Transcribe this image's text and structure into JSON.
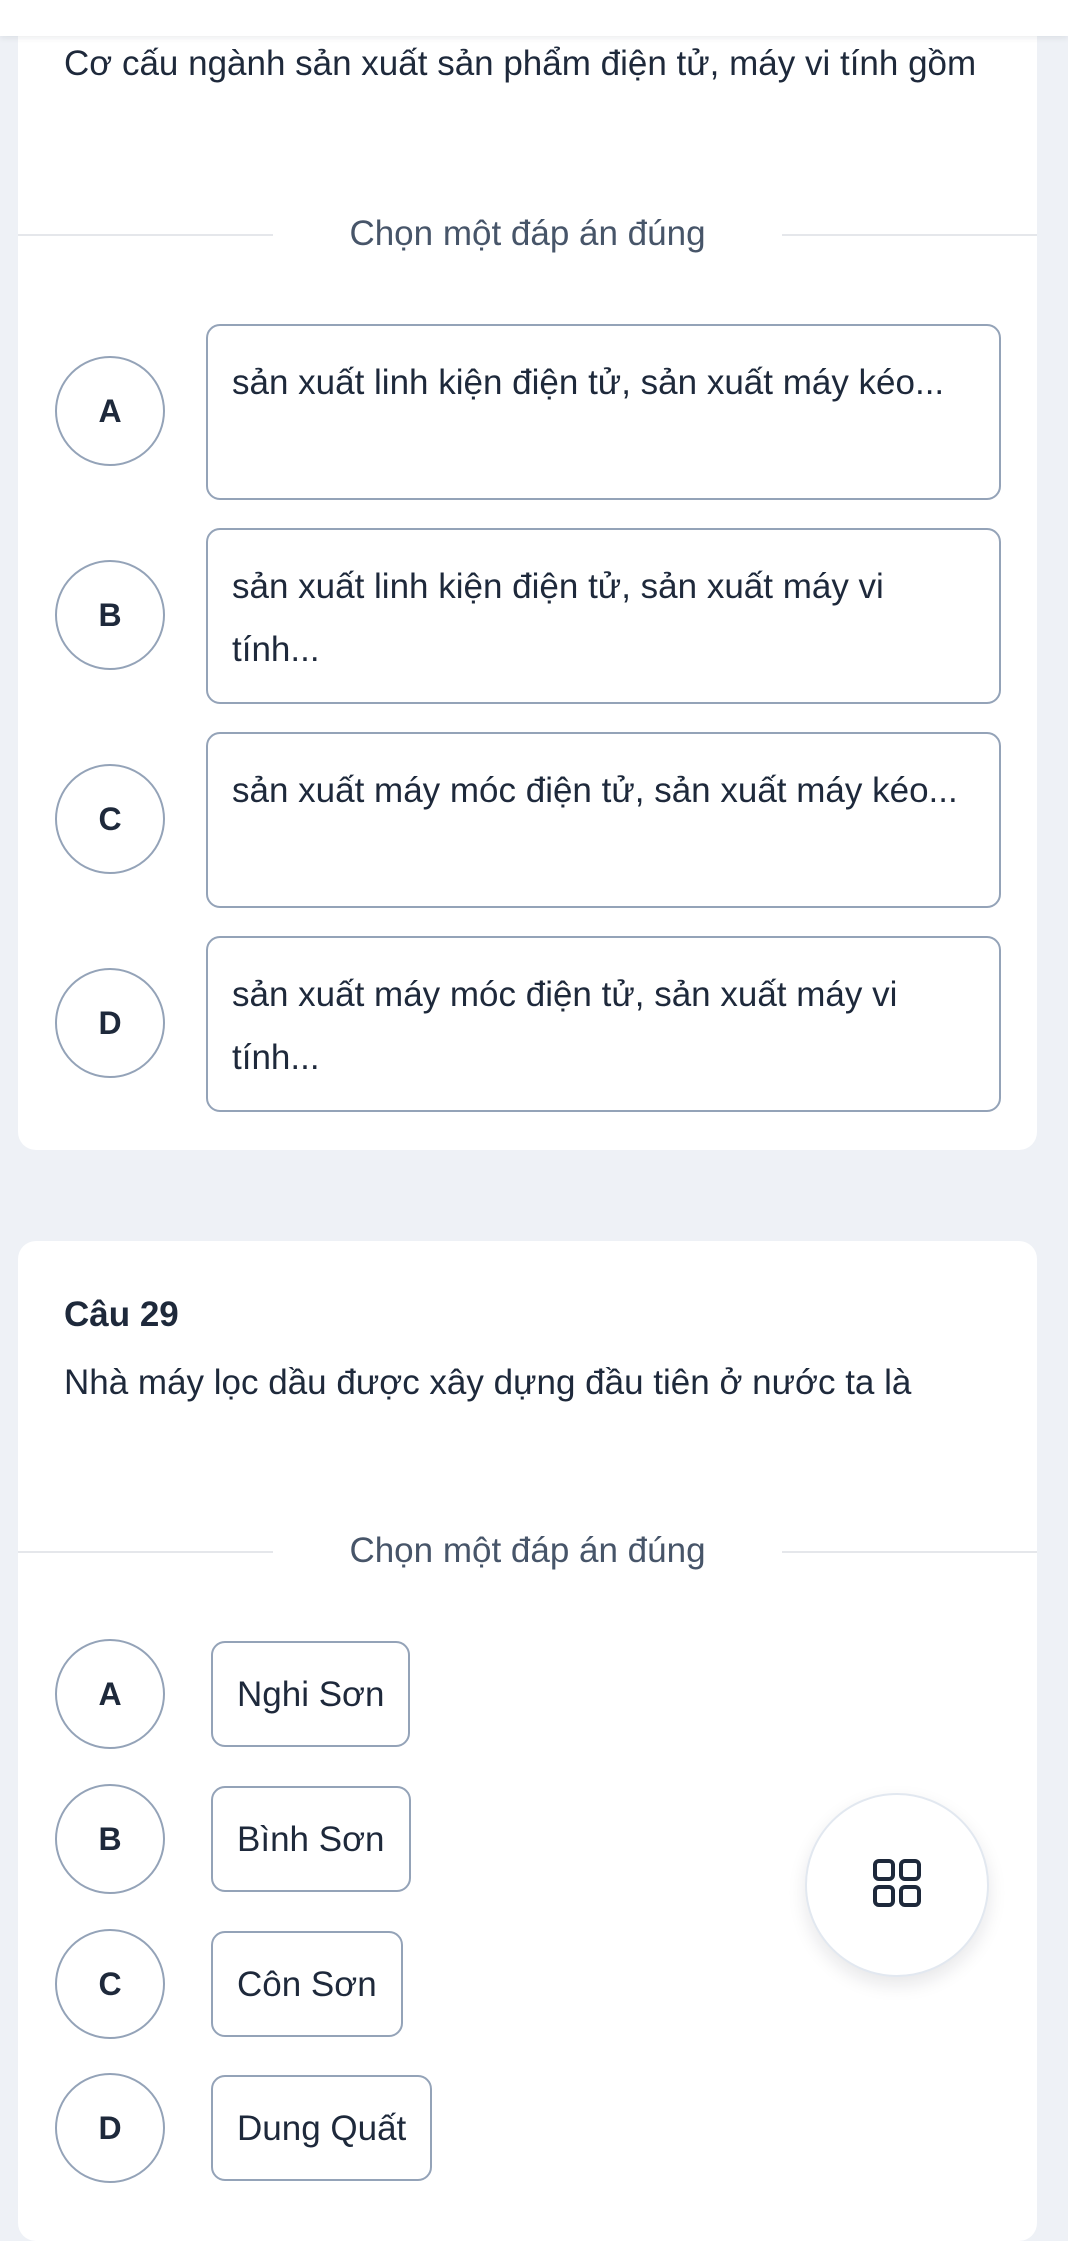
{
  "question_28": {
    "text": "Cơ cấu ngành sản xuất sản phẩm điện tử, máy vi tính gồm",
    "instruction": "Chọn một đáp án đúng",
    "options": [
      {
        "letter": "A",
        "text": "sản xuất linh kiện điện tử, sản xuất máy kéo..."
      },
      {
        "letter": "B",
        "text": "sản xuất linh kiện điện tử, sản xuất máy vi tính..."
      },
      {
        "letter": "C",
        "text": "sản xuất máy móc điện tử, sản xuất máy kéo..."
      },
      {
        "letter": "D",
        "text": "sản xuất máy móc điện tử, sản xuất máy vi tính..."
      }
    ]
  },
  "question_29": {
    "number_label": "Câu 29",
    "text": "Nhà máy lọc dầu được xây dựng đầu tiên ở nước ta là",
    "instruction": "Chọn một đáp án đúng",
    "options": [
      {
        "letter": "A",
        "text": "Nghi Sơn"
      },
      {
        "letter": "B",
        "text": "Bình Sơn"
      },
      {
        "letter": "C",
        "text": "Côn Sơn"
      },
      {
        "letter": "D",
        "text": "Dung Quất"
      }
    ]
  },
  "fab": {
    "icon": "grid-icon"
  },
  "colors": {
    "background": "#eef1f6",
    "card": "#ffffff",
    "text": "#1e293b",
    "muted_text": "#475569",
    "option_border": "#94a3b8",
    "divider": "#e5e7eb"
  }
}
